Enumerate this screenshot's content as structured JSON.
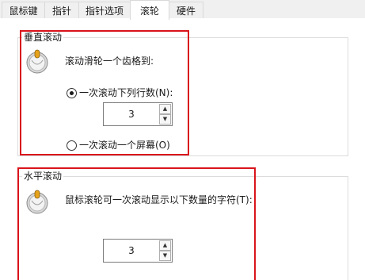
{
  "tabs": [
    {
      "label": "鼠标键"
    },
    {
      "label": "指针"
    },
    {
      "label": "指针选项"
    },
    {
      "label": "滚轮"
    },
    {
      "label": "硬件"
    }
  ],
  "active_tab": "滚轮",
  "vertical": {
    "title": "垂直滚动",
    "heading": "滚动滑轮一个齿格到:",
    "option_lines": "一次滚动下列行数(N):",
    "lines_value": "3",
    "option_screen": "一次滚动一个屏幕(O)",
    "selected": "lines"
  },
  "horizontal": {
    "title": "水平滚动",
    "heading": "鼠标滚轮可一次滚动显示以下数量的字符(T):",
    "chars_value": "3"
  },
  "icons": {
    "mouse": "mouse-wheel-icon",
    "spin_up": "arrow-up-icon",
    "spin_down": "arrow-down-icon"
  },
  "colors": {
    "highlight_box": "#d9141b",
    "panel_bg": "#ffffff",
    "window_bg": "#f0f0f0"
  }
}
